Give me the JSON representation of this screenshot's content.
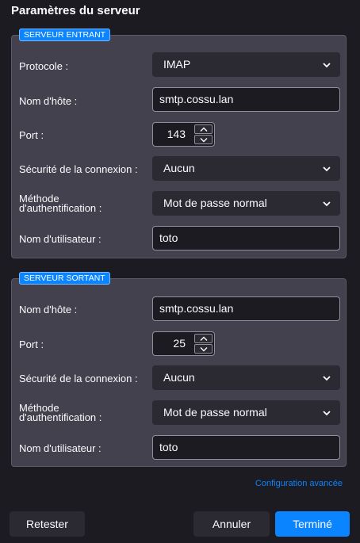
{
  "dialog": {
    "title": "Paramètres du serveur"
  },
  "incoming": {
    "legend": "SERVEUR ENTRANT",
    "protocol": {
      "label": "Protocole :",
      "value": "IMAP"
    },
    "hostname": {
      "label": "Nom d'hôte :",
      "value": "smtp.cossu.lan"
    },
    "port": {
      "label": "Port :",
      "value": "143"
    },
    "security": {
      "label": "Sécurité de la connexion :",
      "value": "Aucun"
    },
    "auth": {
      "label_line1": "Méthode",
      "label_line2": "d'authentification :",
      "value": "Mot de passe normal"
    },
    "username": {
      "label": "Nom d'utilisateur :",
      "value": "toto"
    }
  },
  "outgoing": {
    "legend": "SERVEUR SORTANT",
    "hostname": {
      "label": "Nom d'hôte :",
      "value": "smtp.cossu.lan"
    },
    "port": {
      "label": "Port :",
      "value": "25"
    },
    "security": {
      "label": "Sécurité de la connexion :",
      "value": "Aucun"
    },
    "auth": {
      "label_line1": "Méthode",
      "label_line2": "d'authentification :",
      "value": "Mot de passe normal"
    },
    "username": {
      "label": "Nom d'utilisateur :",
      "value": "toto"
    }
  },
  "advanced_link": "Configuration avancée",
  "buttons": {
    "retest": "Retester",
    "cancel": "Annuler",
    "done": "Terminé"
  },
  "colors": {
    "accent": "#0a84ff",
    "panel": "#42414d",
    "background": "#1c1b22"
  }
}
